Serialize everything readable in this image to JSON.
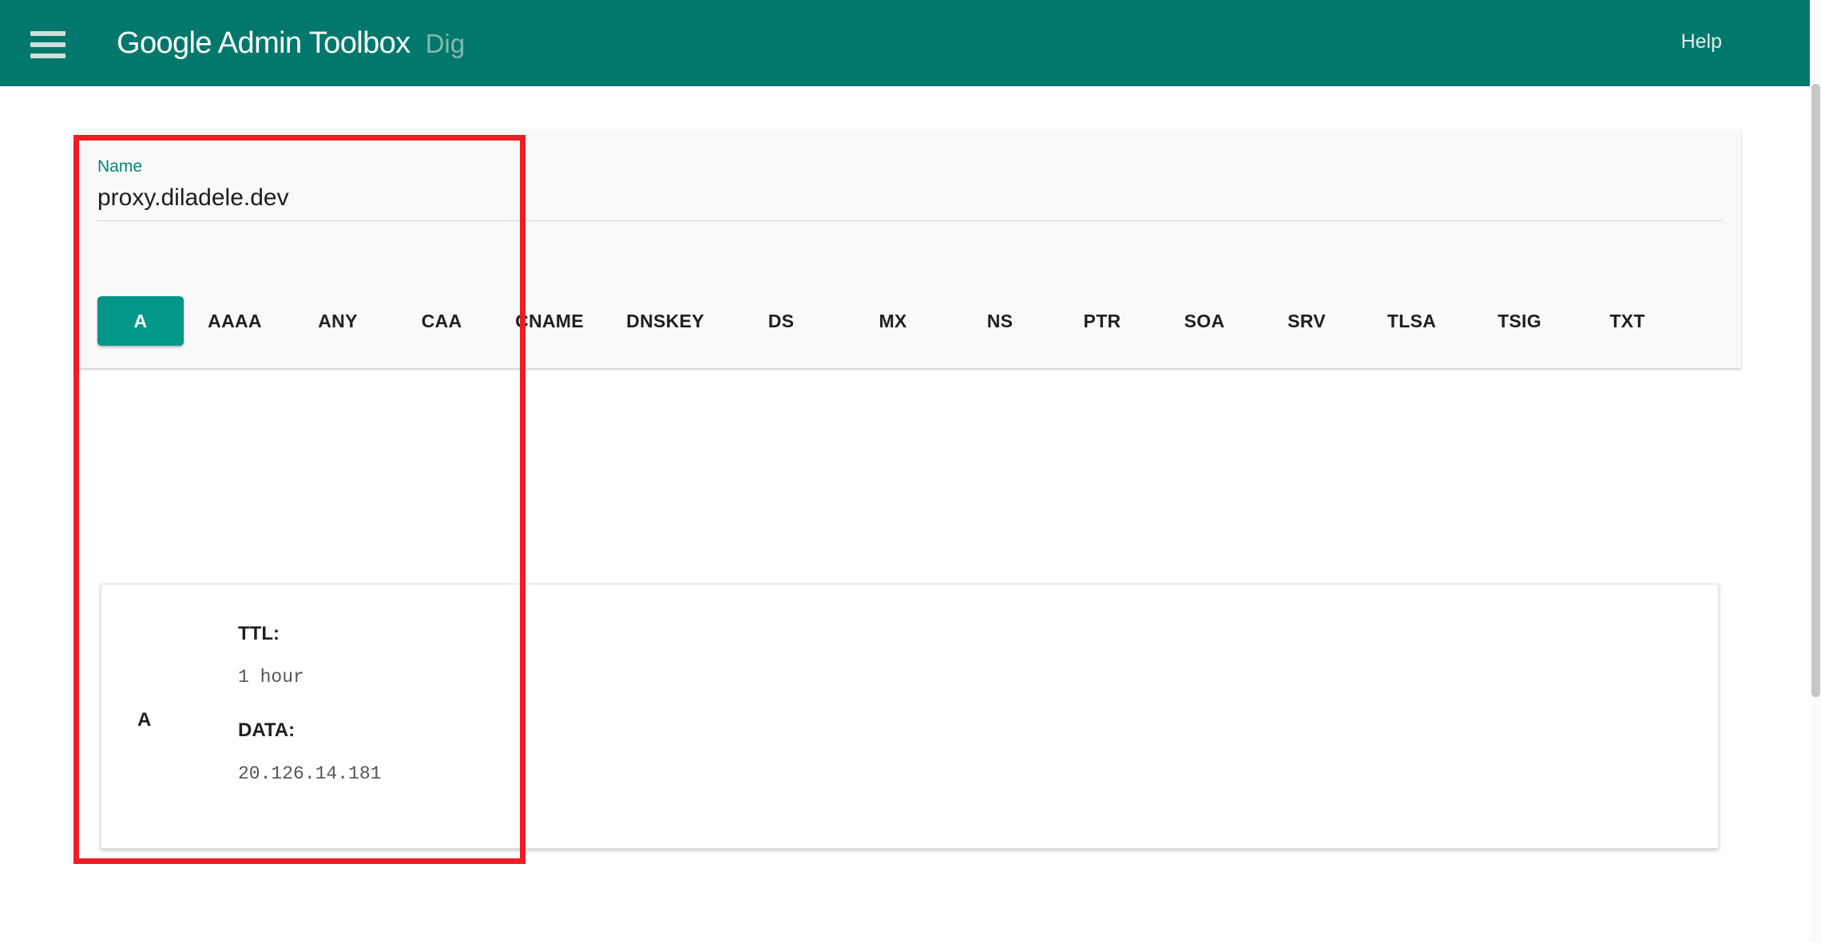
{
  "header": {
    "menu_icon": "hamburger-menu-icon",
    "brand": "Google Admin Toolbox",
    "tool": "Dig",
    "help_label": "Help",
    "background_color": "#00786b"
  },
  "query": {
    "name_label": "Name",
    "name_value": "proxy.diladele.dev",
    "name_placeholder": "Name",
    "accent_color": "#00897b",
    "record_types": [
      "A",
      "AAAA",
      "ANY",
      "CAA",
      "CNAME",
      "DNSKEY",
      "DS",
      "MX",
      "NS",
      "PTR",
      "SOA",
      "SRV",
      "TLSA",
      "TSIG",
      "TXT"
    ],
    "selected_record_type": "A",
    "selected_color": "#009688"
  },
  "results": {
    "records": [
      {
        "type": "A",
        "ttl_key": "TTL:",
        "ttl_value": "1 hour",
        "data_key": "DATA:",
        "data_value": "20.126.14.181"
      }
    ]
  },
  "annotation": {
    "color": "#ee1c25",
    "shape": "rectangle"
  }
}
